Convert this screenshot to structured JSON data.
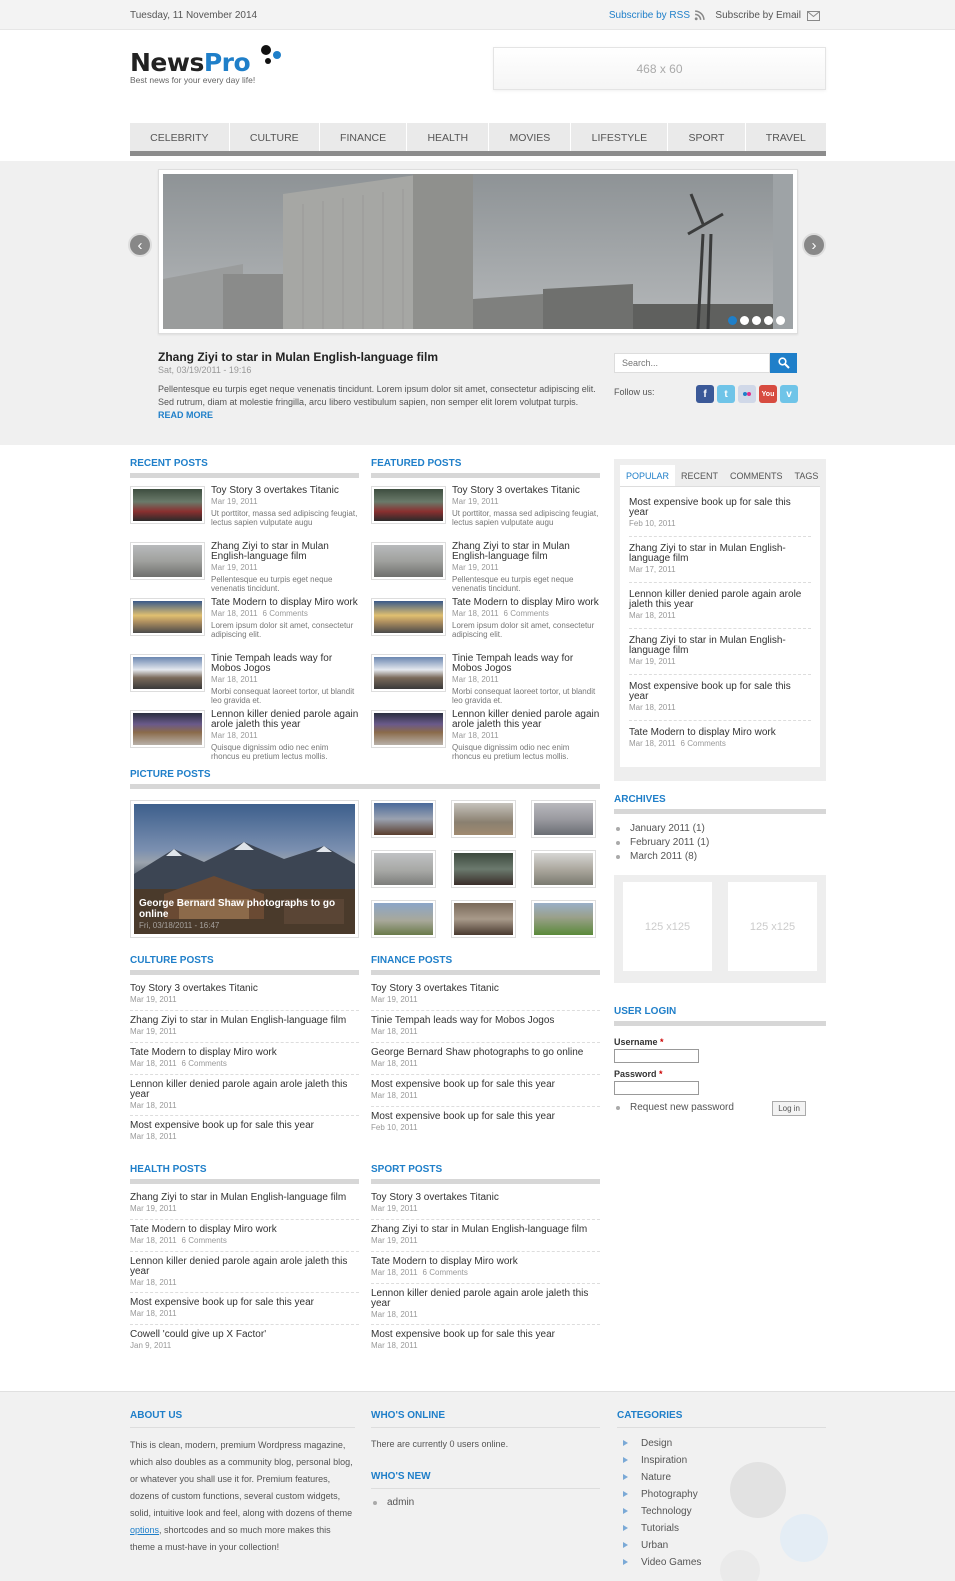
{
  "topbar": {
    "date": "Tuesday, 11 November 2014",
    "subscribe_rss": "Subscribe by RSS",
    "subscribe_email": "Subscribe by Email"
  },
  "logo": {
    "name_a": "News",
    "name_b": "Pro",
    "tagline": "Best news for your every day life!"
  },
  "ad_banner": "468 x 60",
  "nav": [
    "CELEBRITY",
    "CULTURE",
    "FINANCE",
    "HEALTH",
    "MOVIES",
    "LIFESTYLE",
    "SPORT",
    "TRAVEL"
  ],
  "slider": {
    "prev": "‹",
    "next": "›",
    "title": "Zhang Ziyi to star in Mulan English-language film",
    "date": "Sat, 03/19/2011 - 19:16",
    "excerpt": "Pellentesque eu turpis eget neque venenatis tincidunt. Lorem ipsum dolor sit amet, consectetur adipiscing elit. Sed rutrum, diam at molestie fringilla, arcu libero vestibulum sapien, non semper elit lorem volutpat turpis.",
    "read_more": "READ MORE",
    "pager_count": 5,
    "pager_active": 0
  },
  "search": {
    "placeholder": "Search..."
  },
  "follow": {
    "label": "Follow us:",
    "networks": [
      "f",
      "t",
      "fl",
      "yt",
      "v"
    ]
  },
  "recent": {
    "heading": "RECENT POSTS",
    "items": [
      {
        "title": "Toy Story 3 overtakes Titanic",
        "date": "Mar 19, 2011",
        "comments": "",
        "excerpt": "Ut porttitor, massa sed adipiscing feugiat, lectus sapien vulputate augu"
      },
      {
        "title": "Zhang Ziyi to star in Mulan English-language film",
        "date": "Mar 19, 2011",
        "comments": "",
        "excerpt": "Pellentesque eu turpis eget neque venenatis tincidunt."
      },
      {
        "title": "Tate Modern to display Miro work",
        "date": "Mar 18, 2011",
        "comments": "6 Comments",
        "excerpt": "Lorem ipsum dolor sit amet, consectetur adipiscing elit."
      },
      {
        "title": "Tinie Tempah leads way for Mobos Jogos",
        "date": "Mar 18, 2011",
        "comments": "",
        "excerpt": "Morbi consequat laoreet tortor, ut blandit leo gravida et."
      },
      {
        "title": "Lennon killer denied parole again arole jaleth this year",
        "date": "Mar 18, 2011",
        "comments": "",
        "excerpt": "Quisque dignissim odio nec enim rhoncus eu pretium lectus mollis."
      }
    ]
  },
  "featured": {
    "heading": "FEATURED POSTS",
    "items": [
      {
        "title": "Toy Story 3 overtakes Titanic",
        "date": "Mar 19, 2011",
        "comments": "",
        "excerpt": "Ut porttitor, massa sed adipiscing feugiat, lectus sapien vulputate augu"
      },
      {
        "title": "Zhang Ziyi to star in Mulan English-language film",
        "date": "Mar 19, 2011",
        "comments": "",
        "excerpt": "Pellentesque eu turpis eget neque venenatis tincidunt."
      },
      {
        "title": "Tate Modern to display Miro work",
        "date": "Mar 18, 2011",
        "comments": "6 Comments",
        "excerpt": "Lorem ipsum dolor sit amet, consectetur adipiscing elit."
      },
      {
        "title": "Tinie Tempah leads way for Mobos Jogos",
        "date": "Mar 18, 2011",
        "comments": "",
        "excerpt": "Morbi consequat laoreet tortor, ut blandit leo gravida et."
      },
      {
        "title": "Lennon killer denied parole again arole jaleth this year",
        "date": "Mar 18, 2011",
        "comments": "",
        "excerpt": "Quisque dignissim odio nec enim rhoncus eu pretium lectus mollis."
      }
    ]
  },
  "picture": {
    "heading": "PICTURE POSTS",
    "caption": "George Bernard Shaw photographs to go online",
    "caption_date": "Fri, 03/18/2011 - 16:47"
  },
  "culture": {
    "heading": "CULTURE POSTS",
    "items": [
      {
        "title": "Toy Story 3 overtakes Titanic",
        "date": "Mar 19, 2011",
        "comments": ""
      },
      {
        "title": "Zhang Ziyi to star in Mulan English-language film",
        "date": "Mar 19, 2011",
        "comments": ""
      },
      {
        "title": "Tate Modern to display Miro work",
        "date": "Mar 18, 2011",
        "comments": "6 Comments"
      },
      {
        "title": "Lennon killer denied parole again arole jaleth this year",
        "date": "Mar 18, 2011",
        "comments": ""
      },
      {
        "title": "Most expensive book up for sale this year",
        "date": "Mar 18, 2011",
        "comments": ""
      }
    ]
  },
  "finance": {
    "heading": "FINANCE POSTS",
    "items": [
      {
        "title": "Toy Story 3 overtakes Titanic",
        "date": "Mar 19, 2011",
        "comments": ""
      },
      {
        "title": "Tinie Tempah leads way for Mobos Jogos",
        "date": "Mar 18, 2011",
        "comments": ""
      },
      {
        "title": "George Bernard Shaw photographs to go online",
        "date": "Mar 18, 2011",
        "comments": ""
      },
      {
        "title": "Most expensive book up for sale this year",
        "date": "Mar 18, 2011",
        "comments": ""
      },
      {
        "title": "Most expensive book up for sale this year",
        "date": "Feb 10, 2011",
        "comments": ""
      }
    ]
  },
  "health": {
    "heading": "HEALTH POSTS",
    "items": [
      {
        "title": "Zhang Ziyi to star in Mulan English-language film",
        "date": "Mar 19, 2011",
        "comments": ""
      },
      {
        "title": "Tate Modern to display Miro work",
        "date": "Mar 18, 2011",
        "comments": "6 Comments"
      },
      {
        "title": "Lennon killer denied parole again arole jaleth this year",
        "date": "Mar 18, 2011",
        "comments": ""
      },
      {
        "title": "Most expensive book up for sale this year",
        "date": "Mar 18, 2011",
        "comments": ""
      },
      {
        "title": "Cowell 'could give up X Factor'",
        "date": "Jan 9, 2011",
        "comments": ""
      }
    ]
  },
  "sport": {
    "heading": "SPORT POSTS",
    "items": [
      {
        "title": "Toy Story 3 overtakes Titanic",
        "date": "Mar 19, 2011",
        "comments": ""
      },
      {
        "title": "Zhang Ziyi to star in Mulan English-language film",
        "date": "Mar 19, 2011",
        "comments": ""
      },
      {
        "title": "Tate Modern to display Miro work",
        "date": "Mar 18, 2011",
        "comments": "6 Comments"
      },
      {
        "title": "Lennon killer denied parole again arole jaleth this year",
        "date": "Mar 18, 2011",
        "comments": ""
      },
      {
        "title": "Most expensive book up for sale this year",
        "date": "Mar 18, 2011",
        "comments": ""
      }
    ]
  },
  "tabs": {
    "labels": [
      "POPULAR",
      "RECENT",
      "COMMENTS",
      "TAGS"
    ],
    "active": 0,
    "items": [
      {
        "title": "Most expensive book up for sale this year",
        "date": "Feb 10, 2011",
        "comments": ""
      },
      {
        "title": "Zhang Ziyi to star in Mulan English-language film",
        "date": "Mar 17, 2011",
        "comments": ""
      },
      {
        "title": "Lennon killer denied parole again arole jaleth this year",
        "date": "Mar 18, 2011",
        "comments": ""
      },
      {
        "title": "Zhang Ziyi to star in Mulan English-language film",
        "date": "Mar 19, 2011",
        "comments": ""
      },
      {
        "title": "Most expensive book up for sale this year",
        "date": "Mar 18, 2011",
        "comments": ""
      },
      {
        "title": "Tate Modern to display Miro work",
        "date": "Mar 18, 2011",
        "comments": "6 Comments"
      }
    ]
  },
  "archives": {
    "heading": "ARCHIVES",
    "items": [
      "January 2011 (1)",
      "February 2011 (1)",
      "March 2011 (8)"
    ]
  },
  "ads125": [
    "125 x125",
    "125 x125"
  ],
  "login": {
    "heading": "USER LOGIN",
    "username": "Username",
    "password": "Password",
    "required": "*",
    "request": "Request new password",
    "button": "Log in"
  },
  "footer": {
    "about_heading": "ABOUT US",
    "about_text_a": "This is clean, modern, premium Wordpress magazine, which also doubles as a community blog, personal blog, or whatever you shall use it for. Premium features, dozens of custom functions, several custom widgets, solid, intuitive look and feel, along with dozens of theme ",
    "about_link": "options",
    "about_text_b": ", shortcodes and so much more makes this theme a must-have in your collection!",
    "online_heading": "WHO'S ONLINE",
    "online_text": "There are currently 0 users online.",
    "new_heading": "WHO'S NEW",
    "new_user": "admin",
    "cat_heading": "CATEGORIES",
    "categories": [
      "Design",
      "Inspiration",
      "Nature",
      "Photography",
      "Technology",
      "Tutorials",
      "Urban",
      "Video Games"
    ]
  },
  "colors": {
    "accent": "#1f7fc9",
    "rule": "#d7d7d7",
    "band": "#f0f0f0"
  }
}
